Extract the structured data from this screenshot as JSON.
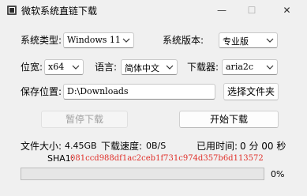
{
  "window": {
    "title": "微软系统直链下载",
    "min_symbol": "—",
    "max_symbol": "☐",
    "close_symbol": "✕"
  },
  "system_type": {
    "label": "系统类型:",
    "value": "Windows 11"
  },
  "system_edition": {
    "label": "系统版本:",
    "value": "专业版"
  },
  "bitness": {
    "label": "位宽:",
    "value": "x64"
  },
  "language": {
    "label": "语言:",
    "value": "简体中文"
  },
  "downloader": {
    "label": "下载器:",
    "value": "aria2c"
  },
  "save_location": {
    "label": "保存位置:",
    "value": "D:\\Downloads",
    "browse_label": "选择文件夹"
  },
  "actions": {
    "pause_label": "暂停下载",
    "start_label": "开始下载"
  },
  "stats": {
    "file_size_label": "文件大小:",
    "file_size_value": "4.45GB",
    "speed_label": "下载速度:",
    "speed_value": "0B/S",
    "elapsed_label": "已用时间:",
    "elapsed_value": "0 分 00 秒"
  },
  "sha1": {
    "label": "SHA1:",
    "value": "081ccd988df1ac2ceb1f731c974d357b6d113572"
  },
  "progress": {
    "percent": 0,
    "text": "0%"
  },
  "colors": {
    "sha_value": "#e0302a",
    "progress_fill": "#06b025"
  }
}
